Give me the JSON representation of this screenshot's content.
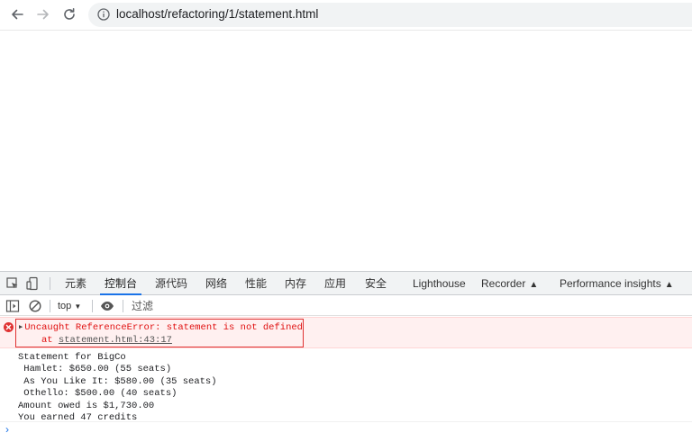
{
  "browser": {
    "url": "localhost/refactoring/1/statement.html"
  },
  "devtools": {
    "tabs": [
      {
        "label": "元素"
      },
      {
        "label": "控制台"
      },
      {
        "label": "源代码"
      },
      {
        "label": "网络"
      },
      {
        "label": "性能"
      },
      {
        "label": "内存"
      },
      {
        "label": "应用"
      },
      {
        "label": "安全"
      },
      {
        "label": "Lighthouse"
      },
      {
        "label": "Recorder",
        "flask": "▲"
      },
      {
        "label": "Performance insights",
        "flask": "▲"
      }
    ],
    "active_tab": "控制台",
    "console_bar": {
      "context": "top",
      "context_caret": "▼",
      "filter_placeholder": "过滤"
    },
    "error": {
      "message": "Uncaught ReferenceError: statement is not defined",
      "at_prefix": "at ",
      "location": "statement.html:43:17"
    },
    "log_lines": [
      "Statement for BigCo",
      " Hamlet: $650.00 (55 seats)",
      " As You Like It: $580.00 (35 seats)",
      " Othello: $500.00 (40 seats)",
      "Amount owed is $1,730.00",
      "You earned 47 credits"
    ],
    "prompt": "›"
  },
  "colors": {
    "accent": "#1a73e8",
    "error": "#e01010",
    "error_bg": "#fff0f0"
  }
}
